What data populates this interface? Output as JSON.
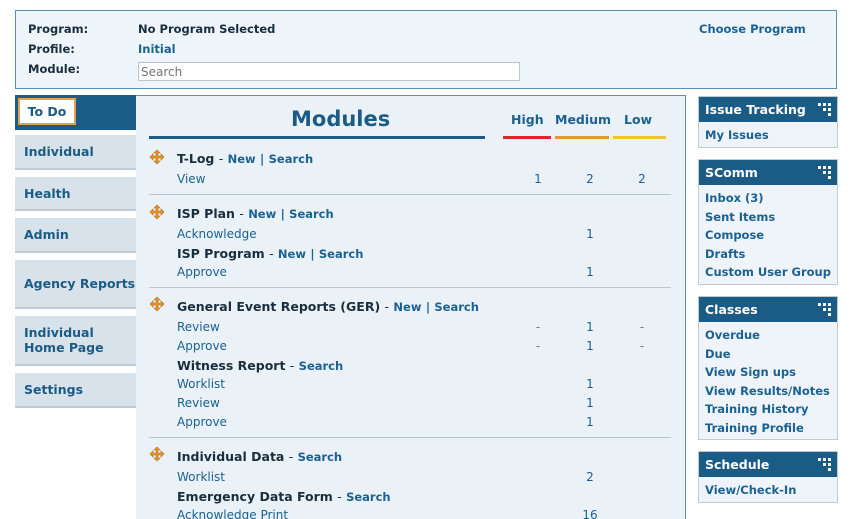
{
  "header": {
    "program_label": "Program:",
    "program_value": "No Program Selected",
    "profile_label": "Profile:",
    "profile_value": "Initial",
    "module_label": "Module:",
    "module_placeholder": "Search",
    "choose_program": "Choose Program"
  },
  "leftnav": {
    "active": "To Do",
    "items": [
      "Individual",
      "Health",
      "Admin",
      "Agency Reports",
      "Individual Home Page",
      "Settings"
    ]
  },
  "modules": {
    "title": "Modules",
    "columns": {
      "high": "High",
      "medium": "Medium",
      "low": "Low"
    },
    "colors": {
      "high": "#d9262a",
      "medium": "#e8952b",
      "low": "#f1c232",
      "accent": "#1b5c86"
    },
    "sections": [
      {
        "icon": "move-icon",
        "groups": [
          {
            "title": "T-Log",
            "links": [
              "New",
              "Search"
            ],
            "rows": [
              {
                "label": "View",
                "high": "1",
                "medium": "2",
                "low": "2"
              }
            ]
          }
        ]
      },
      {
        "icon": "move-icon",
        "groups": [
          {
            "title": "ISP Plan",
            "links": [
              "New",
              "Search"
            ],
            "rows": [
              {
                "label": "Acknowledge",
                "high": "",
                "medium": "1",
                "low": ""
              }
            ]
          },
          {
            "title": "ISP Program",
            "links": [
              "New",
              "Search"
            ],
            "rows": [
              {
                "label": "Approve",
                "high": "",
                "medium": "1",
                "low": ""
              }
            ]
          }
        ]
      },
      {
        "icon": "move-icon",
        "groups": [
          {
            "title": "General Event Reports (GER)",
            "links": [
              "New",
              "Search"
            ],
            "rows": [
              {
                "label": "Review",
                "high": "-",
                "medium": "1",
                "low": "-"
              },
              {
                "label": "Approve",
                "high": "-",
                "medium": "1",
                "low": "-"
              }
            ]
          },
          {
            "title": "Witness Report",
            "links": [
              "Search"
            ],
            "rows": [
              {
                "label": "Worklist",
                "high": "",
                "medium": "1",
                "low": ""
              },
              {
                "label": "Review",
                "high": "",
                "medium": "1",
                "low": ""
              },
              {
                "label": "Approve",
                "high": "",
                "medium": "1",
                "low": ""
              }
            ]
          }
        ]
      },
      {
        "icon": "move-icon",
        "groups": [
          {
            "title": "Individual Data",
            "links": [
              "Search"
            ],
            "rows": [
              {
                "label": "Worklist",
                "high": "",
                "medium": "2",
                "low": ""
              }
            ]
          },
          {
            "title": "Emergency Data Form",
            "links": [
              "Search"
            ],
            "rows": [
              {
                "label": "Acknowledge Print",
                "high": "",
                "medium": "16",
                "low": ""
              }
            ]
          }
        ]
      }
    ]
  },
  "panels": [
    {
      "title": "Issue Tracking",
      "links": [
        "My Issues"
      ]
    },
    {
      "title": "SComm",
      "links": [
        "Inbox (3)",
        "Sent Items",
        "Compose",
        "Drafts",
        "Custom User Group"
      ]
    },
    {
      "title": "Classes",
      "links": [
        "Overdue",
        "Due",
        "View Sign ups",
        "View Results/Notes",
        "Training History",
        "Training Profile"
      ]
    },
    {
      "title": "Schedule",
      "links": [
        "View/Check-In"
      ]
    }
  ]
}
